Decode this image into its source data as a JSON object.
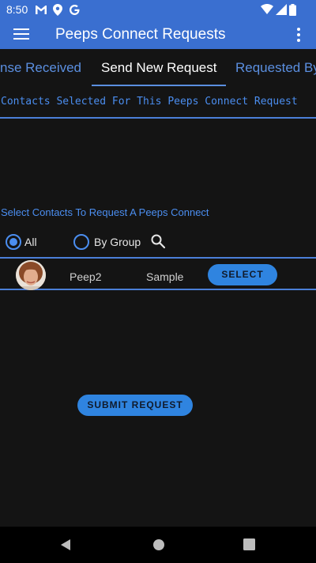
{
  "status_bar": {
    "time": "8:50",
    "icons": [
      "gmail-icon",
      "location-icon",
      "google-icon",
      "wifi-icon",
      "signal-icon",
      "battery-icon"
    ]
  },
  "app_bar": {
    "title": "Peeps Connect Requests",
    "menu_icon": "hamburger-menu-icon",
    "overflow_icon": "more-vert-icon"
  },
  "tabs": [
    {
      "label": "nse Received",
      "active": false
    },
    {
      "label": "Send New Request",
      "active": true
    },
    {
      "label": "Requested By",
      "active": false
    }
  ],
  "selected_section": {
    "heading": "Contacts Selected For This Peeps Connect Request"
  },
  "select_section": {
    "label": "Select Contacts To Request A Peeps Connect",
    "filter_options": [
      {
        "label": "All",
        "checked": true
      },
      {
        "label": "By Group",
        "checked": false
      }
    ],
    "search_icon": "search-icon"
  },
  "contacts": [
    {
      "name": "Peep2",
      "group": "Sample",
      "action_label": "SELECT"
    }
  ],
  "submit_label": "SUBMIT REQUEST",
  "nav_bar": {
    "icons": [
      "back-icon",
      "home-icon",
      "recents-icon"
    ]
  },
  "colors": {
    "primary": "#3a6fd0",
    "accent": "#2f84e0",
    "background": "#141414",
    "link_text": "#4b8ef0"
  }
}
